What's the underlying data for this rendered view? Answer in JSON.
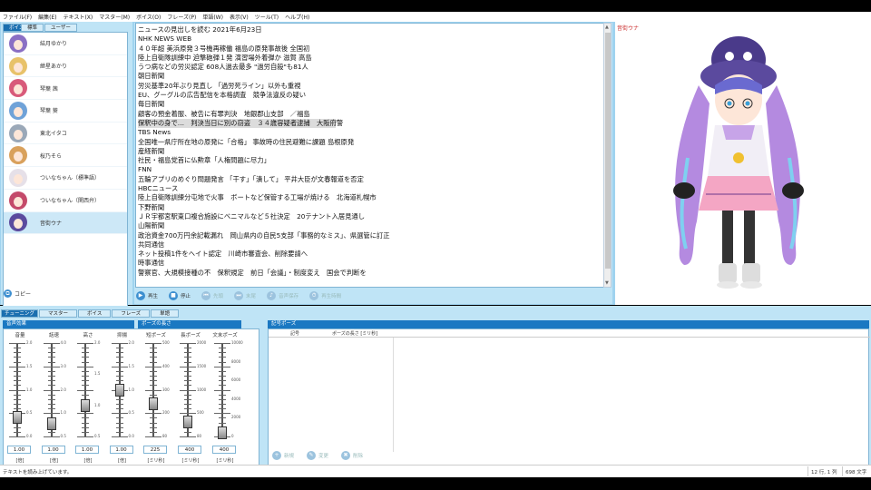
{
  "menu": [
    "ファイル(F)",
    "編集(E)",
    "テキスト(X)",
    "マスター(M)",
    "ボイス(O)",
    "フレーズ(P)",
    "単語(W)",
    "表示(V)",
    "ツール(T)",
    "ヘルプ(H)"
  ],
  "voice_panel": {
    "section_tab": "ボイス",
    "tabs": [
      "標準",
      "ユーザー"
    ],
    "items": [
      {
        "name": "結月ゆかり",
        "color": "#8a6fc4"
      },
      {
        "name": "紲星あかり",
        "color": "#e8c26a"
      },
      {
        "name": "琴葉 茜",
        "color": "#d85a7a"
      },
      {
        "name": "琴葉 葵",
        "color": "#6fa2d8"
      },
      {
        "name": "東北イタコ",
        "color": "#9aa8b8"
      },
      {
        "name": "桜乃そら",
        "color": "#d9a15c"
      },
      {
        "name": "ついなちゃん（標準語）",
        "color": "#e6e0e8"
      },
      {
        "name": "ついなちゃん（関西弁）",
        "color": "#c44a6a"
      },
      {
        "name": "音街ウナ",
        "color": "#5b4a9e"
      }
    ],
    "selected_index": 8,
    "copy_label": "コピー"
  },
  "editor": {
    "lines": [
      "ニュースの見出しを読む 2021年6月23日",
      "",
      "NHK NEWS WEB",
      "４０年超 美浜原発３号機再稼働 福島の原発事故後 全国初",
      "陸上自衛隊訓練中 迫撃砲弾１発 演習場外着弾か 滋賀 高島",
      "うつ病などの労災認定 608人過去最多 \"過労自殺\"も81人",
      "朝日新聞",
      "労災基準20年ぶり見直し 「過労死ライン」以外も重視",
      "EU、グーグルの広告配信を本格調査　競争法違反の疑い",
      "毎日新聞",
      "顧客の預金着服、被告に有罪判決　地銀郡山支部　／福島",
      "保釈中の身で…　判決当日に別の窃盗　３４歳容疑者逮捕　大阪府警",
      "TBS News",
      "全国唯一県庁所在地の原発に「合格」 事故時の住民避難に課題 島根原発",
      "産経新聞",
      "社民・福島党首に仏勲章「人権問題に尽力」",
      "FNN",
      "五輪アプリのめぐり問題発言 「干す」「潰して」 平井大臣が文春報道を否定",
      "HBCニュース",
      "陸上自衛隊訓練分屯地で火事　ボートなど保管する工場が焼ける　北海道札幌市",
      "下野新聞",
      "ＪＲ宇都宮駅東口複合施設にベニマルなど５社決定　20テナント入居見通し",
      "山陽新聞",
      "政治資金700万円余記載漏れ　岡山県内の自民5支部「事務的なミス」、県選管に訂正",
      "共同通信",
      "ネット投稿1件をヘイト認定　川崎市審査会、削除要請へ",
      "時事通信",
      "警察官、大規模接種の不　保釈規定　前日「会議」・制度変え　国会で判断を"
    ],
    "highlight_index": 11
  },
  "playbar": [
    {
      "icon": "play-icon",
      "glyph": "▶",
      "label": "再生",
      "enabled": true
    },
    {
      "icon": "stop-icon",
      "glyph": "■",
      "label": "停止",
      "enabled": true
    },
    {
      "icon": "first-icon",
      "glyph": "⏮",
      "label": "先頭",
      "enabled": false
    },
    {
      "icon": "last-icon",
      "glyph": "⏭",
      "label": "末尾",
      "enabled": false
    },
    {
      "icon": "save-audio-icon",
      "glyph": "♪",
      "label": "音声保存",
      "enabled": false
    },
    {
      "icon": "time-icon",
      "glyph": "⏱",
      "label": "再生時間",
      "enabled": false
    }
  ],
  "character": {
    "name": "音街ウナ"
  },
  "tuning": {
    "section_tab": "チューニング",
    "tabs": [
      "マスター",
      "ボイス",
      "フレーズ",
      "単語"
    ],
    "voice_effects_title": "音声効果",
    "pause_length_title": "ポーズの長さ",
    "sliders": [
      {
        "name": "volume",
        "label": "音量",
        "value": "1.00",
        "unit": "[倍]",
        "fraction": 0.2,
        "ticks": [
          "2.0",
          "1.5",
          "1.0",
          "0.5",
          "0.0"
        ]
      },
      {
        "name": "speed",
        "label": "話速",
        "value": "1.00",
        "unit": "[倍]",
        "fraction": 0.133,
        "ticks": [
          "4.0",
          "3.0",
          "2.0",
          "1.0",
          "0.5"
        ]
      },
      {
        "name": "pitch",
        "label": "高さ",
        "value": "1.00",
        "unit": "[倍]",
        "fraction": 0.333,
        "ticks": [
          "2.0",
          "1.5",
          "1.0",
          "0.5"
        ]
      },
      {
        "name": "intonation",
        "label": "抑揚",
        "value": "1.00",
        "unit": "[倍]",
        "fraction": 0.5,
        "ticks": [
          "2.0",
          "1.5",
          "1.0",
          "0.5",
          "0.0"
        ]
      },
      {
        "name": "short-pause",
        "label": "短ポーズ",
        "value": "225",
        "unit": "[ミリ秒]",
        "fraction": 0.35,
        "ticks": [
          "500",
          "400",
          "300",
          "200",
          "80"
        ]
      },
      {
        "name": "long-pause",
        "label": "長ポーズ",
        "value": "400",
        "unit": "[ミリ秒]",
        "fraction": 0.16,
        "ticks": [
          "2000",
          "1500",
          "1000",
          "500",
          "80"
        ]
      },
      {
        "name": "sentence-pause",
        "label": "文末ポーズ",
        "value": "400",
        "unit": "[ミリ秒]",
        "fraction": 0.04,
        "ticks": [
          "10000",
          "8000",
          "6000",
          "4000",
          "2000",
          "0"
        ]
      }
    ],
    "symbol_pause_title": "記号ポーズ",
    "symbol_table_headers": [
      "記号",
      "ポーズの長さ [ミリ秒]"
    ],
    "symbol_buttons": [
      {
        "icon": "new-icon",
        "glyph": "+",
        "label": "新規"
      },
      {
        "icon": "edit-icon",
        "glyph": "✎",
        "label": "変更"
      },
      {
        "icon": "delete-icon",
        "glyph": "✖",
        "label": "削除"
      }
    ]
  },
  "status": {
    "message": "テキストを読み上げています。",
    "position": "12 行, 1 列",
    "count": "698 文字"
  }
}
